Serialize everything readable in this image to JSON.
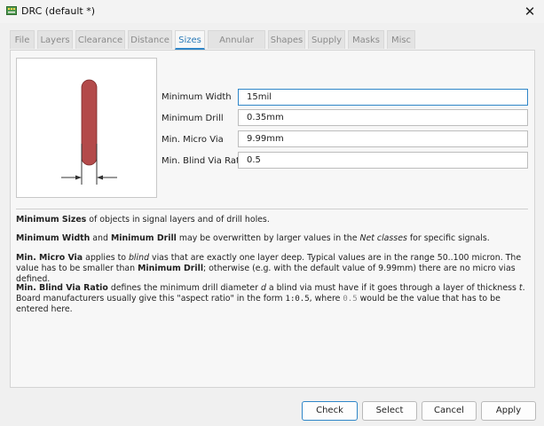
{
  "window": {
    "title": "DRC (default *)",
    "close_symbol": "✕"
  },
  "tabs": [
    {
      "label": "File"
    },
    {
      "label": "Layers"
    },
    {
      "label": "Clearance"
    },
    {
      "label": "Distance"
    },
    {
      "label": "Sizes"
    },
    {
      "label": "Annular Ring"
    },
    {
      "label": "Shapes"
    },
    {
      "label": "Supply"
    },
    {
      "label": "Masks"
    },
    {
      "label": "Misc"
    }
  ],
  "active_tab": "Sizes",
  "fields": {
    "min_width": {
      "label": "Minimum Width",
      "value": "15mil"
    },
    "min_drill": {
      "label": "Minimum Drill",
      "value": "0.35mm"
    },
    "min_micro_via": {
      "label": "Min. Micro Via",
      "value": "9.99mm"
    },
    "min_blind_via_ratio": {
      "label": "Min. Blind Via Ratio",
      "value": "0.5"
    }
  },
  "help": {
    "p1": {
      "b1": "Minimum Sizes",
      "t1": " of objects in signal layers and of drill holes."
    },
    "p2": {
      "b1": "Minimum Width",
      "t1": " and ",
      "b2": "Minimum Drill",
      "t2": " may be overwritten by larger values in the ",
      "i1": "Net classes",
      "t3": " for specific signals."
    },
    "p3": {
      "b1": "Min. Micro Via",
      "t1": " applies to ",
      "i1": "blind",
      "t2": " vias that are exactly one layer deep. Typical values are in the range 50..100 micron. The value has to be smaller than ",
      "b2": "Minimum Drill",
      "t3": "; otherwise (e.g. with the default value of 9.99mm) there are no micro vias defined."
    },
    "p4": {
      "b1": "Min. Blind Via Ratio",
      "t1": " defines the minimum drill diameter ",
      "i1": "d",
      "t2": " a blind via must have if it goes through a layer of thickness ",
      "i2": "t",
      "t3": ". Board manufacturers usually give this \"aspect ratio\" in the form ",
      "c1": "1:0.5",
      "t4": ", where ",
      "c2": "0.5",
      "t5": " would be the value that has to be entered here."
    }
  },
  "buttons": {
    "check": "Check",
    "select": "Select",
    "cancel": "Cancel",
    "apply": "Apply"
  },
  "colors": {
    "accent": "#2f86c8",
    "trace": "#b34a4a"
  },
  "icons": {
    "app": "drc-board-icon",
    "close": "close-icon"
  }
}
